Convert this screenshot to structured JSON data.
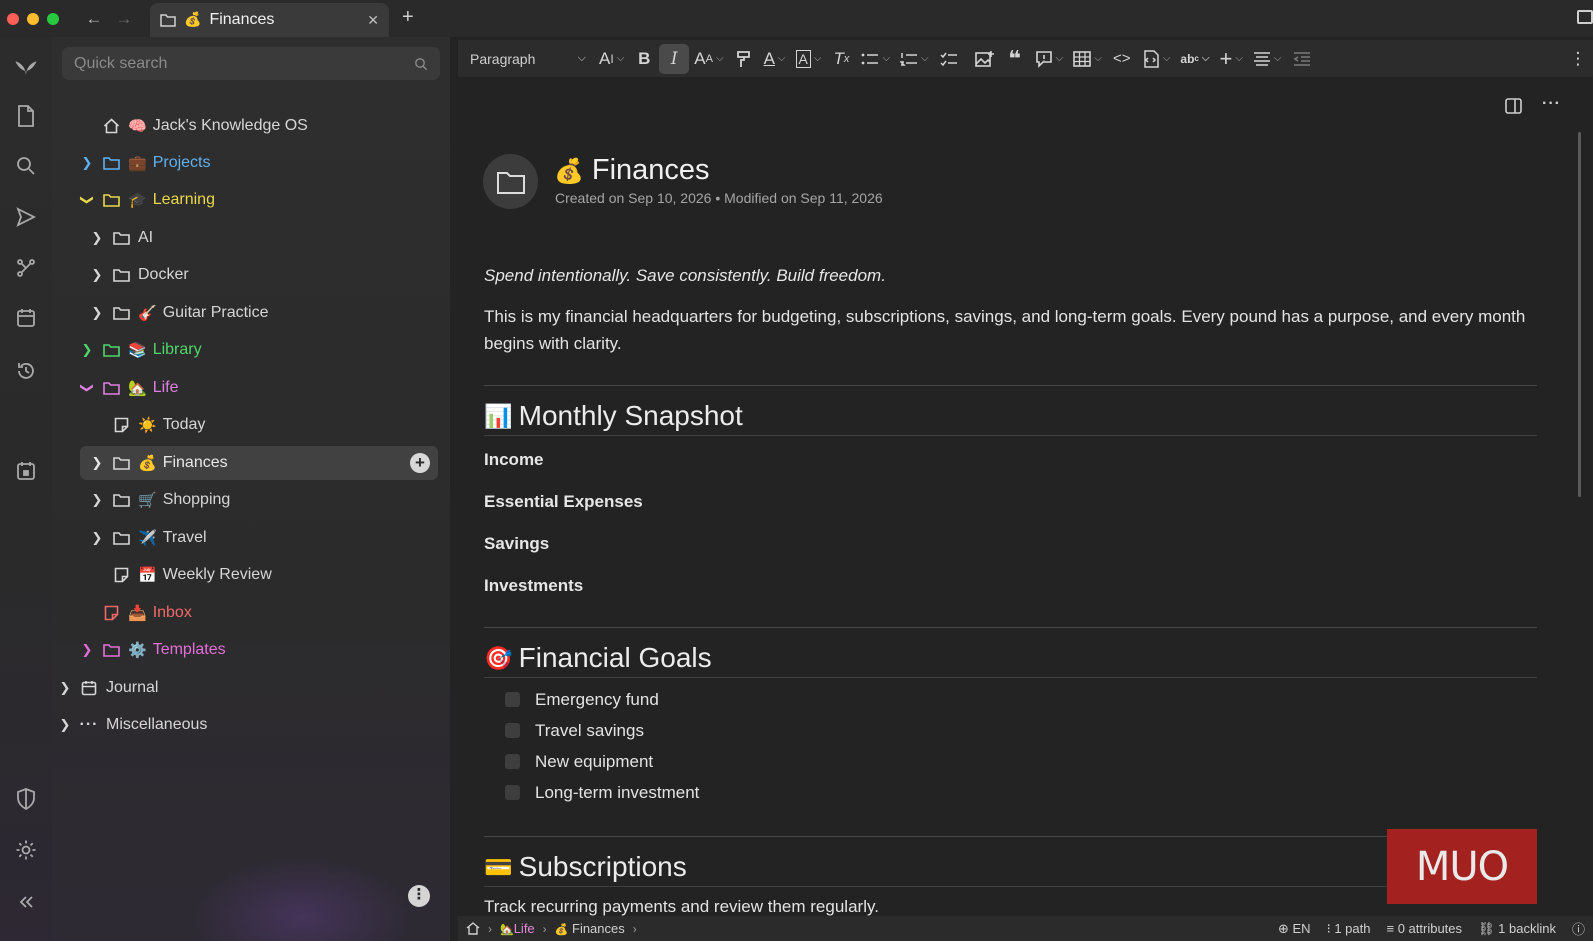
{
  "titlebar": {
    "tab_title": "Finances",
    "tab_emoji": "💰",
    "close_glyph": "✕",
    "new_tab_glyph": "+",
    "back_glyph": "←",
    "forward_glyph": "→"
  },
  "sidebar": {
    "search_placeholder": "Quick search",
    "items": [
      {
        "label": "Jack's Knowledge OS",
        "emoji": "🧠",
        "color": "#d6d6d6"
      },
      {
        "label": "Projects",
        "emoji": "💼",
        "color": "#5fb1f2"
      },
      {
        "label": "Learning",
        "emoji": "🎓",
        "color": "#e9d84c"
      },
      {
        "label": "AI",
        "emoji": "",
        "color": "#d6d6d6"
      },
      {
        "label": "Docker",
        "emoji": "",
        "color": "#d6d6d6"
      },
      {
        "label": "Guitar Practice",
        "emoji": "🎸",
        "color": "#d6d6d6"
      },
      {
        "label": "Library",
        "emoji": "📚",
        "color": "#4fd66a"
      },
      {
        "label": "Life",
        "emoji": "🏡",
        "color": "#dd7fe0"
      },
      {
        "label": "Today",
        "emoji": "☀️",
        "color": "#d6d6d6"
      },
      {
        "label": "Finances",
        "emoji": "💰",
        "color": "#e8e8e8"
      },
      {
        "label": "Shopping",
        "emoji": "🛒",
        "color": "#d6d6d6"
      },
      {
        "label": "Travel",
        "emoji": "✈️",
        "color": "#d6d6d6"
      },
      {
        "label": "Weekly Review",
        "emoji": "📅",
        "color": "#d6d6d6"
      },
      {
        "label": "Inbox",
        "emoji": "📥",
        "color": "#ef6a6a"
      },
      {
        "label": "Templates",
        "emoji": "⚙️",
        "color": "#e46fd8"
      },
      {
        "label": "Journal",
        "emoji": "",
        "color": "#d6d6d6"
      },
      {
        "label": "Miscellaneous",
        "emoji": "",
        "color": "#d6d6d6"
      }
    ]
  },
  "toolbar": {
    "block_type": "Paragraph"
  },
  "note": {
    "emoji": "💰",
    "title": "Finances",
    "meta": "Created on Sep 10, 2026 • Modified on Sep 11, 2026",
    "tagline": "Spend intentionally. Save consistently. Build freedom.",
    "intro": "This is my financial headquarters for budgeting, subscriptions, savings, and long-term goals. Every pound has a purpose, and every month begins with clarity.",
    "snapshot": {
      "emoji": "📊",
      "heading": "Monthly Snapshot",
      "items": [
        "Income",
        "Essential Expenses",
        "Savings",
        "Investments"
      ]
    },
    "goals": {
      "emoji": "🎯",
      "heading": "Financial Goals",
      "items": [
        "Emergency fund",
        "Travel savings",
        "New equipment",
        "Long-term investment"
      ]
    },
    "subscriptions": {
      "emoji": "💳",
      "heading": "Subscriptions",
      "text": "Track recurring payments and review them regularly."
    }
  },
  "watermark": "MUO",
  "statusbar": {
    "crumb_life": "Life",
    "crumb_life_emoji": "🏡",
    "crumb_finances": "Finances",
    "crumb_finances_emoji": "💰",
    "lang": "EN",
    "paths": "1 path",
    "attributes": "0 attributes",
    "backlinks": "1 backlink"
  }
}
